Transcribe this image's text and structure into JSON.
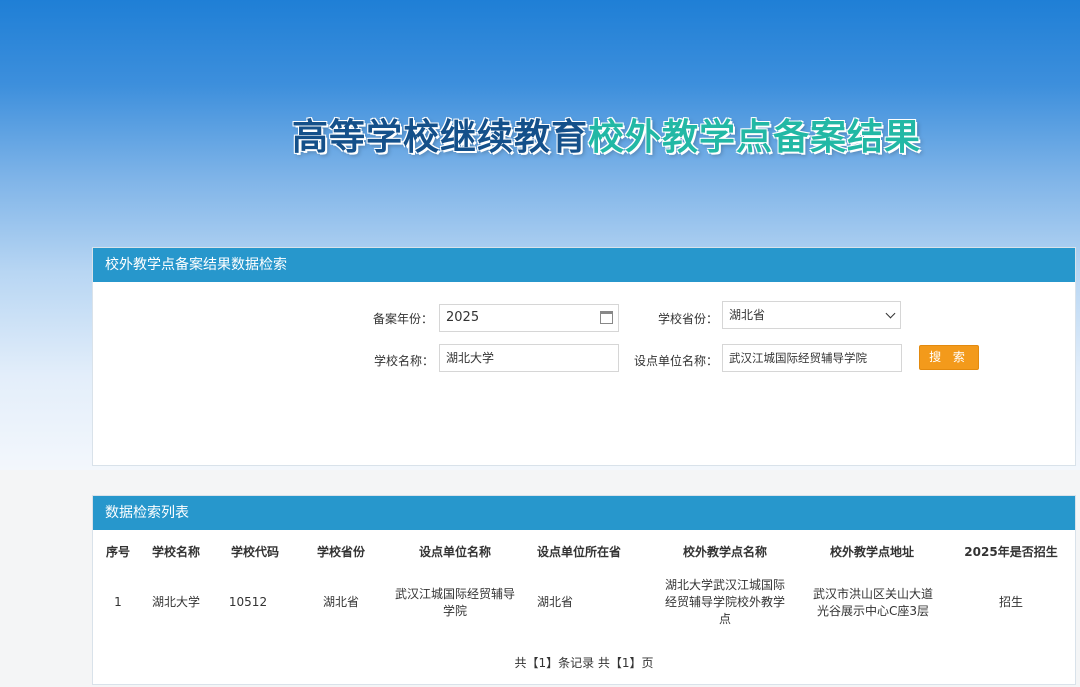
{
  "header": {
    "title_part1": "高等学校继续教育",
    "title_part2": "校外教学点备案结果"
  },
  "search_panel": {
    "title": "校外教学点备案结果数据检索",
    "year_label": "备案年份：",
    "year_value": "2025",
    "province_label": "学校省份：",
    "province_value": "湖北省",
    "school_label": "学校名称：",
    "school_value": "湖北大学",
    "unit_label": "设点单位名称：",
    "unit_value": "武汉江城国际经贸辅导学院",
    "search_button": "搜 索"
  },
  "list_panel": {
    "title": "数据检索列表",
    "columns": [
      "序号",
      "学校名称",
      "学校代码",
      "学校省份",
      "设点单位名称",
      "设点单位所在省",
      "校外教学点名称",
      "校外教学点地址",
      "2025年是否招生"
    ],
    "rows": [
      [
        "1",
        "湖北大学",
        "10512",
        "湖北省",
        "武汉江城国际经贸辅导学院",
        "湖北省",
        "湖北大学武汉江城国际经贸辅导学院校外教学点",
        "武汉市洪山区关山大道光谷展示中心C座3层",
        "招生"
      ]
    ],
    "pager": "共【1】条记录 共【1】页"
  }
}
